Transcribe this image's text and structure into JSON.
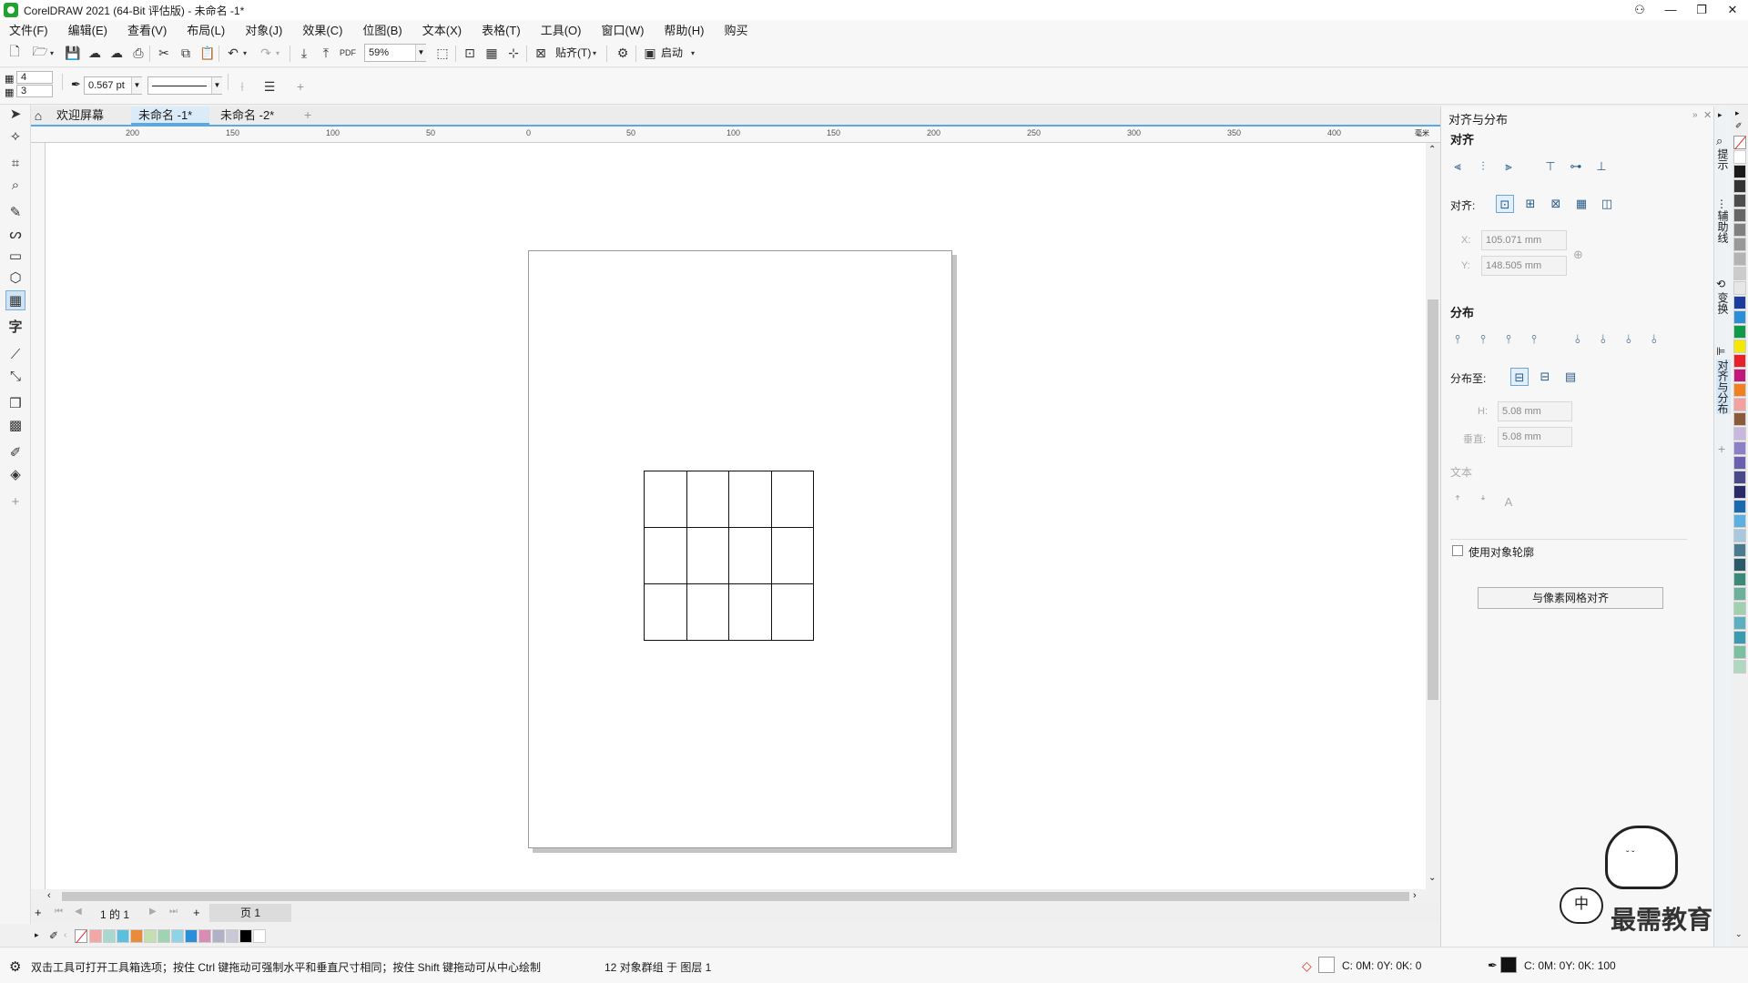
{
  "app": {
    "title": "CorelDRAW 2021 (64-Bit 评估版) - 未命名 -1*"
  },
  "menu": [
    "文件(F)",
    "编辑(E)",
    "查看(V)",
    "布局(L)",
    "对象(J)",
    "效果(C)",
    "位图(B)",
    "文本(X)",
    "表格(T)",
    "工具(O)",
    "窗口(W)",
    "帮助(H)",
    "购买"
  ],
  "toolbar": {
    "zoom": "59%",
    "snap_label": "贴齐(T)",
    "launch_label": "启动"
  },
  "propbar": {
    "rows": "4",
    "cols": "3",
    "outline_width": "0.567 pt"
  },
  "tabs": [
    {
      "label": "欢迎屏幕",
      "active": false
    },
    {
      "label": "未命名 -1*",
      "active": true
    },
    {
      "label": "未命名 -2*",
      "active": false
    }
  ],
  "ruler_ticks": [
    "200",
    "150",
    "100",
    "50",
    "0",
    "50",
    "100",
    "150",
    "200",
    "250",
    "300",
    "350",
    "400"
  ],
  "ruler_unit": "毫米",
  "page_nav": {
    "counter": "1 的 1",
    "page_tab": "页 1"
  },
  "status": {
    "hint": "双击工具可打开工具箱选项；按住 Ctrl 键拖动可强制水平和垂直尺寸相同；按住 Shift 键拖动可从中心绘制",
    "selection": "12 对象群组 于 图层 1",
    "fill_cmyk": "C: 0M: 0Y: 0K: 0",
    "outline_cmyk": "C: 0M: 0Y: 0K: 100"
  },
  "docker": {
    "title": "对齐与分布",
    "align_section": "对齐",
    "align_to_label": "对齐:",
    "x_label": "X:",
    "x_value": "105.071 mm",
    "y_label": "Y:",
    "y_value": "148.505 mm",
    "distribute_section": "分布",
    "distribute_to_label": "分布至:",
    "h_label": "H:",
    "h_value": "5.08 mm",
    "v_label": "垂直:",
    "v_value": "5.08 mm",
    "text_section": "文本",
    "use_outline_label": "使用对象轮廓",
    "pixel_grid_button": "与像素网格对齐"
  },
  "side_tabs": [
    "提示",
    "辅助线",
    "变换",
    "对齐与分布"
  ],
  "watermark": {
    "text": "最需教育",
    "bubble": "中"
  },
  "grid": {
    "rows": 3,
    "cols": 4
  },
  "doc_palette_colors": [
    "#f2a7a7",
    "#a8d8d0",
    "#5bc0de",
    "#e98b3a",
    "#c4e0b2",
    "#9ed4b2",
    "#8fd3e6",
    "#2a8fd6",
    "#d98cb3",
    "#b0b0c8",
    "#c8c8d8",
    "#000000",
    "#ffffff"
  ],
  "palette_colors": [
    "#ffffff",
    "#1a1a1a",
    "#333333",
    "#4d4d4d",
    "#666666",
    "#808080",
    "#999999",
    "#b3b3b3",
    "#cccccc",
    "#e6e6e6",
    "#1a3c9e",
    "#2a8fd6",
    "#0f9a4a",
    "#f5e800",
    "#e8202a",
    "#c2187a",
    "#f08020",
    "#f5a0a0",
    "#8a5a3a",
    "#c8b8e0",
    "#8c7fc8",
    "#6a5fb0",
    "#4a4a8a",
    "#2a2a6a",
    "#1a6ab0",
    "#5ab0e0",
    "#a8c8e0",
    "#4a7a90",
    "#2a5a6a",
    "#3a8a7a",
    "#6ab09a",
    "#a0d0b0",
    "#5ab0c0",
    "#3a9ab0",
    "#7ac0a0",
    "#b0d8c0"
  ]
}
